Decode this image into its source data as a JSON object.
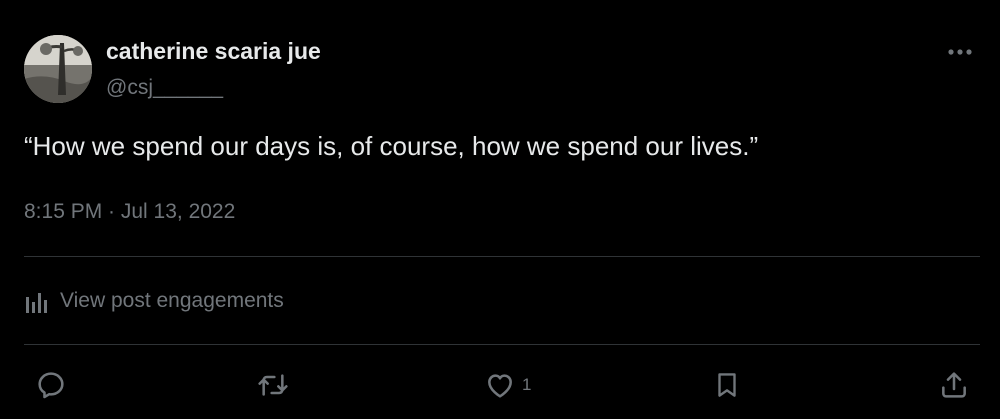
{
  "post": {
    "author": {
      "display_name": "catherine scaria jue",
      "handle": "@csj______"
    },
    "text": "“How we spend our days is, of course, how we spend our lives.”",
    "timestamp": "8:15 PM · Jul 13, 2022",
    "engagements_label": "View post engagements",
    "actions": {
      "reply": {
        "icon": "reply-icon"
      },
      "repost": {
        "icon": "repost-icon"
      },
      "like": {
        "icon": "heart-icon",
        "count": "1"
      },
      "bookmark": {
        "icon": "bookmark-icon"
      },
      "share": {
        "icon": "share-icon"
      }
    },
    "more_icon": "more-icon"
  },
  "colors": {
    "background": "#000000",
    "primary_text": "#e7e9ea",
    "secondary_text": "#71767b",
    "divider": "#2f3336"
  }
}
